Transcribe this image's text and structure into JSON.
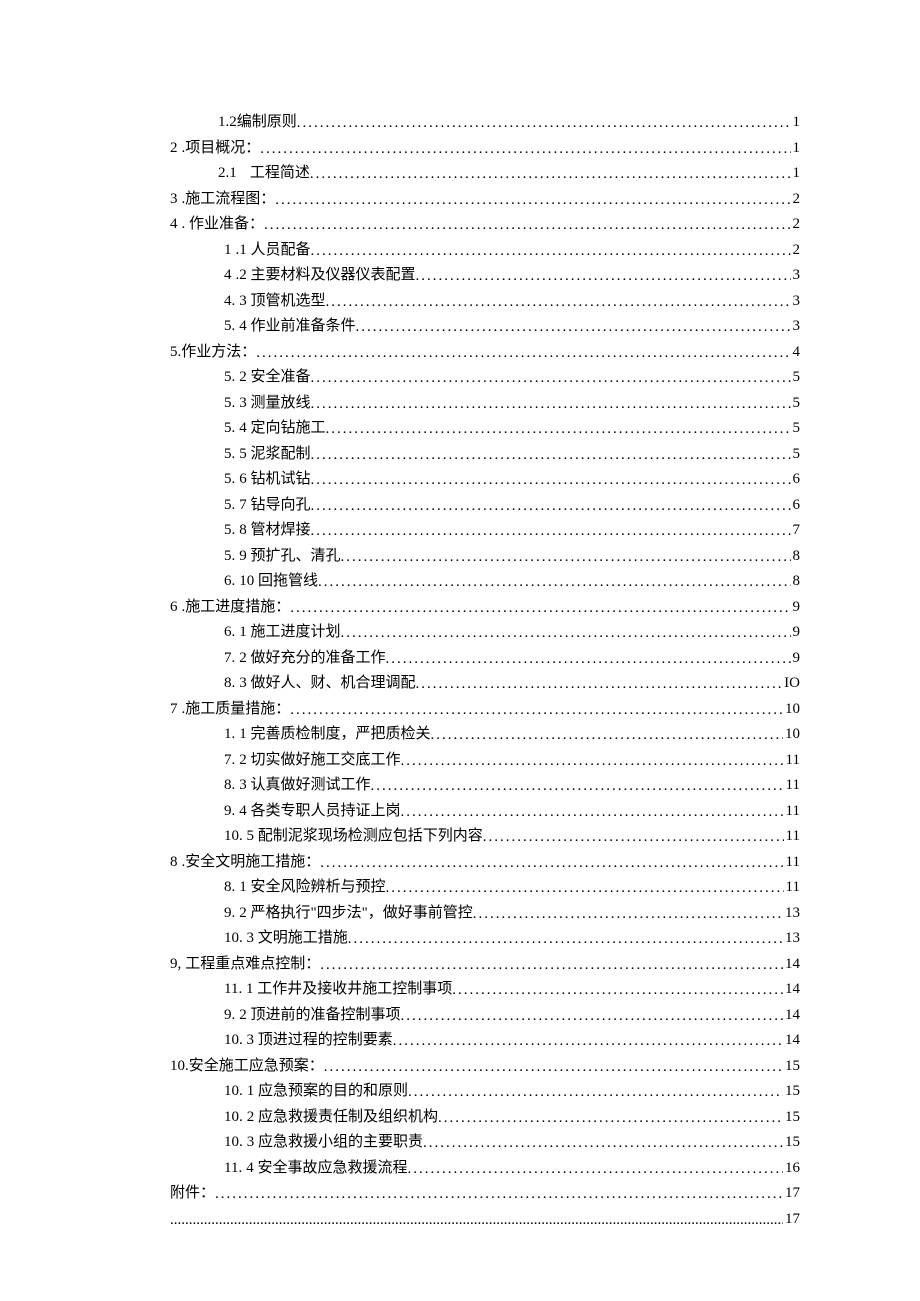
{
  "toc": [
    {
      "indent": 1,
      "num": "",
      "label": "1.2编制原则",
      "page": "1",
      "dense": false
    },
    {
      "indent": 0,
      "num": "2",
      "label": ".项目概况：",
      "page": "1",
      "dense": false
    },
    {
      "indent": 1,
      "num": "2.1",
      "label": "工程简述",
      "page": "1",
      "dense": false,
      "gap": true
    },
    {
      "indent": 0,
      "num": "3",
      "label": ".施工流程图：",
      "page": "2",
      "dense": false
    },
    {
      "indent": 0,
      "num": "4",
      "label": ". 作业准备：",
      "page": "2",
      "dense": false
    },
    {
      "indent": 2,
      "num": "1",
      "label": ".1 人员配备",
      "page": "2",
      "dense": false
    },
    {
      "indent": 2,
      "num": "4",
      "label": ".2 主要材料及仪器仪表配置",
      "page": "3",
      "dense": false
    },
    {
      "indent": 2,
      "num": "4.",
      "label": "3 顶管机选型",
      "page": "3",
      "dense": false
    },
    {
      "indent": 2,
      "num": "5.",
      "label": "4 作业前准备条件",
      "page": "3",
      "dense": false
    },
    {
      "indent": 0,
      "num": "",
      "label": "5.作业方法：",
      "page": "4",
      "dense": false
    },
    {
      "indent": 2,
      "num": "5.",
      "label": "2 安全准备",
      "page": "5",
      "dense": false
    },
    {
      "indent": 2,
      "num": "5.",
      "label": "3 测量放线",
      "page": "5",
      "dense": false
    },
    {
      "indent": 2,
      "num": "5.",
      "label": "4 定向钻施工",
      "page": "5",
      "dense": false
    },
    {
      "indent": 2,
      "num": "5.",
      "label": "5 泥浆配制",
      "page": "5",
      "dense": false
    },
    {
      "indent": 2,
      "num": "5.",
      "label": "6 钻机试钻",
      "page": "6",
      "dense": false
    },
    {
      "indent": 2,
      "num": "5.",
      "label": "7 钻导向孔",
      "page": "6",
      "dense": false
    },
    {
      "indent": 2,
      "num": "5.",
      "label": "8 管材焊接",
      "page": "7",
      "dense": false
    },
    {
      "indent": 2,
      "num": "5.",
      "label": "9 预扩孔、清孔",
      "page": "8",
      "dense": false
    },
    {
      "indent": 2,
      "num": "6.",
      "label": "10 回拖管线",
      "page": "8",
      "dense": false
    },
    {
      "indent": 0,
      "num": "6",
      "label": ".施工进度措施：",
      "page": "9",
      "dense": false
    },
    {
      "indent": 2,
      "num": "6.",
      "label": "1 施工进度计划",
      "page": "9",
      "dense": false
    },
    {
      "indent": 2,
      "num": "7.",
      "label": "2 做好充分的准备工作",
      "page": "9",
      "dense": false
    },
    {
      "indent": 2,
      "num": "8.",
      "label": "3 做好人、财、机合理调配",
      "page": "IO",
      "dense": false
    },
    {
      "indent": 0,
      "num": "7",
      "label": ".施工质量措施：",
      "page": "10",
      "dense": false
    },
    {
      "indent": 2,
      "num": "1.",
      "label": "1 完善质检制度，严把质检关",
      "page": "10",
      "dense": false
    },
    {
      "indent": 2,
      "num": "7.",
      "label": "2 切实做好施工交底工作",
      "page": "11",
      "dense": false
    },
    {
      "indent": 2,
      "num": "8.",
      "label": "3 认真做好测试工作",
      "page": "11",
      "dense": false
    },
    {
      "indent": 2,
      "num": "9.",
      "label": "4 各类专职人员持证上岗",
      "page": "11",
      "dense": false
    },
    {
      "indent": 2,
      "num": "",
      "label": "10. 5 配制泥浆现场检测应包括下列内容",
      "page": "11",
      "dense": false
    },
    {
      "indent": 0,
      "num": "8",
      "label": ".安全文明施工措施：",
      "page": "11",
      "dense": false
    },
    {
      "indent": 2,
      "num": "8.",
      "label": "1 安全风险辨析与预控",
      "page": "11",
      "dense": false
    },
    {
      "indent": 2,
      "num": "9.",
      "label": "2 严格执行\"四步法\"，做好事前管控",
      "page": "13",
      "dense": false
    },
    {
      "indent": 2,
      "num": "",
      "label": "10. 3 文明施工措施",
      "page": "13",
      "dense": false
    },
    {
      "indent": 0,
      "num": "9,",
      "label": "工程重点难点控制：",
      "page": "14",
      "dense": false
    },
    {
      "indent": 2,
      "num": "",
      "label": "11. 1 工作井及接收井施工控制事项",
      "page": "14",
      "dense": false
    },
    {
      "indent": 2,
      "num": "9.",
      "label": "2 顶进前的准备控制事项",
      "page": "14",
      "dense": false
    },
    {
      "indent": 2,
      "num": "",
      "label": "10. 3 顶进过程的控制要素",
      "page": "14",
      "dense": false
    },
    {
      "indent": 0,
      "num": "",
      "label": "10.安全施工应急预案：",
      "page": "15",
      "dense": false
    },
    {
      "indent": 2,
      "num": "10.",
      "label": "1 应急预案的目的和原则",
      "page": "15",
      "dense": false
    },
    {
      "indent": 2,
      "num": "10.",
      "label": "2 应急救援责任制及组织机构",
      "page": "15",
      "dense": false
    },
    {
      "indent": 2,
      "num": "10.",
      "label": "3 应急救援小组的主要职责",
      "page": "15",
      "dense": false
    },
    {
      "indent": 2,
      "num": "11.",
      "label": "4 安全事故应急救援流程",
      "page": "16",
      "dense": false
    },
    {
      "indent": 0,
      "num": "",
      "label": "附件：",
      "page": "17",
      "dense": false
    },
    {
      "indent": 0,
      "num": "",
      "label": "",
      "page": "17",
      "dense": true
    }
  ]
}
